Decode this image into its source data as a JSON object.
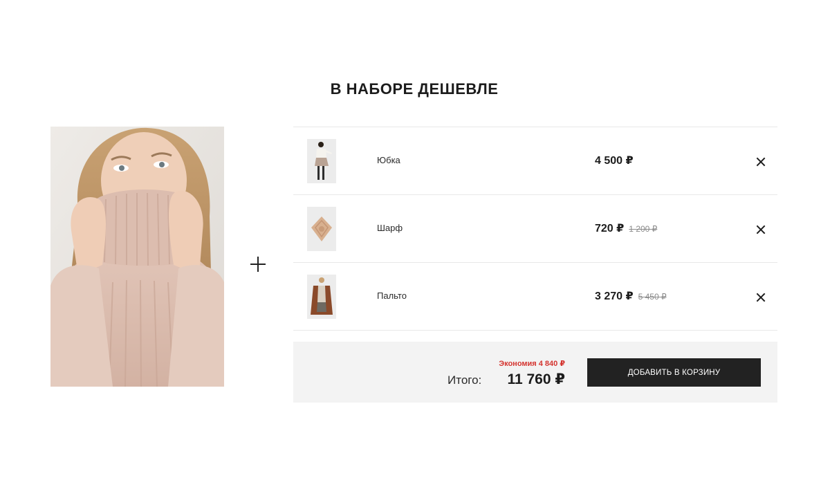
{
  "section": {
    "title": "В НАБОРЕ ДЕШЕВЛЕ"
  },
  "hero": {
    "icon": "model-photo"
  },
  "items": [
    {
      "name": "Юбка",
      "price": "4 500 ₽",
      "old_price": "",
      "thumb_icon": "skirt-outfit"
    },
    {
      "name": "Шарф",
      "price": "720 ₽",
      "old_price": "1 200 ₽",
      "thumb_icon": "scarf"
    },
    {
      "name": "Пальто",
      "price": "3 270 ₽",
      "old_price": "5 450 ₽",
      "thumb_icon": "coat-outfit"
    }
  ],
  "summary": {
    "savings": "Экономия 4 840 ₽",
    "total_label": "Итого:",
    "total": "11 760 ₽",
    "add_button": "ДОБАВИТЬ В КОРЗИНУ"
  },
  "colors": {
    "accent_red": "#d4342f",
    "button_bg": "#222222",
    "summary_bg": "#f3f3f3"
  }
}
